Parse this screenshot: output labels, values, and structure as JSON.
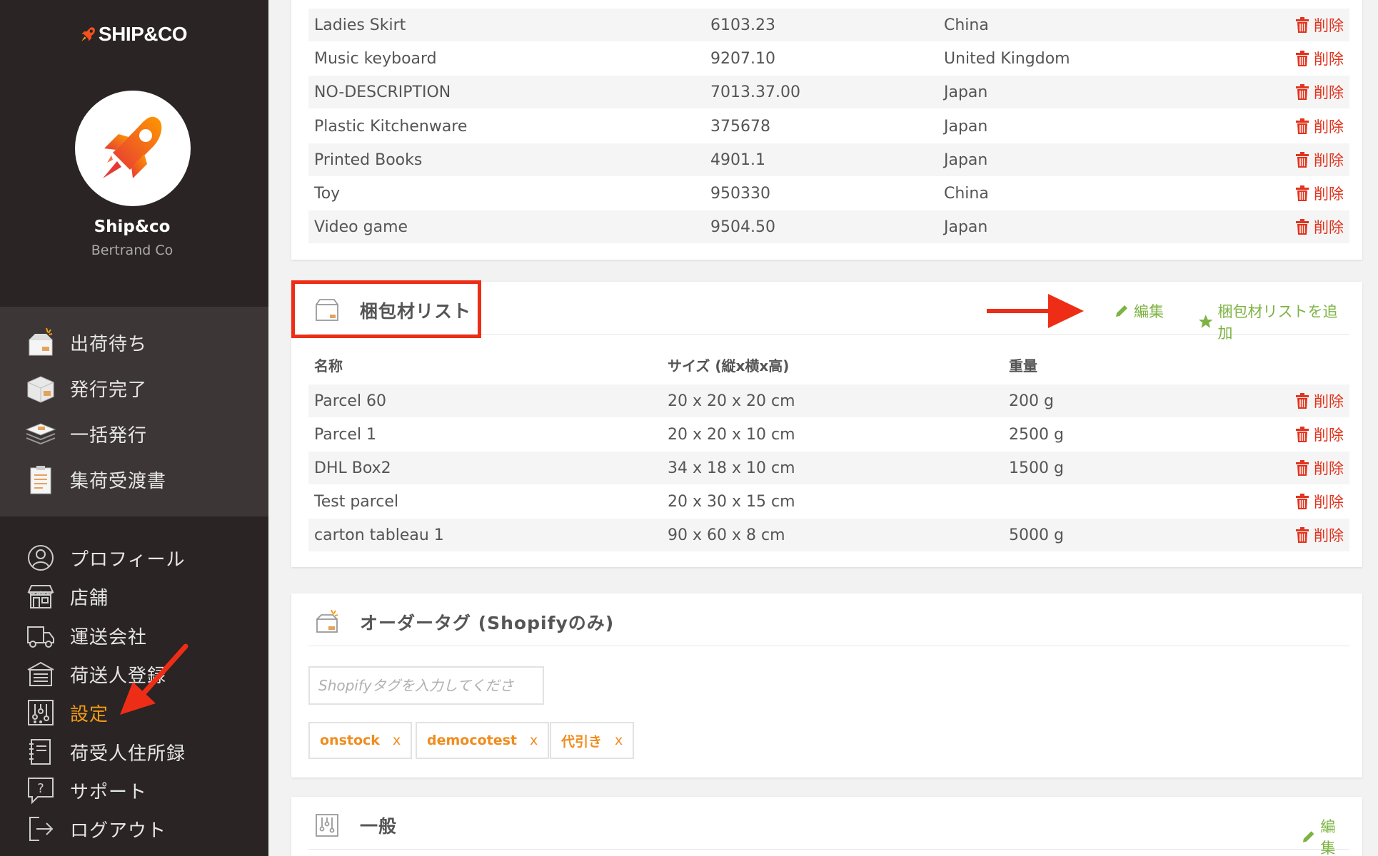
{
  "brand": {
    "logo_text": "SHIP&CO",
    "name": "Ship&co",
    "subtitle": "Bertrand Co"
  },
  "nav_primary": [
    {
      "label": "出荷待ち",
      "icon": "box-open-icon"
    },
    {
      "label": "発行完了",
      "icon": "box-closed-icon"
    },
    {
      "label": "一括発行",
      "icon": "stack-icon"
    },
    {
      "label": "集荷受渡書",
      "icon": "clipboard-icon"
    }
  ],
  "nav_secondary": [
    {
      "label": "プロフィール",
      "icon": "user-icon"
    },
    {
      "label": "店舗",
      "icon": "store-icon"
    },
    {
      "label": "運送会社",
      "icon": "truck-icon"
    },
    {
      "label": "荷送人登録",
      "icon": "warehouse-icon"
    },
    {
      "label": "設定",
      "icon": "sliders-icon",
      "active": true
    },
    {
      "label": "荷受人住所録",
      "icon": "address-book-icon"
    },
    {
      "label": "サポート",
      "icon": "help-icon"
    },
    {
      "label": "ログアウト",
      "icon": "logout-icon"
    }
  ],
  "products": {
    "rows": [
      {
        "name": "Ladies Skirt",
        "code": "6103.23",
        "origin": "China"
      },
      {
        "name": "Music keyboard",
        "code": "9207.10",
        "origin": "United Kingdom"
      },
      {
        "name": "NO-DESCRIPTION",
        "code": "7013.37.00",
        "origin": "Japan"
      },
      {
        "name": "Plastic Kitchenware",
        "code": "375678",
        "origin": "Japan"
      },
      {
        "name": "Printed Books",
        "code": "4901.1",
        "origin": "Japan"
      },
      {
        "name": "Toy",
        "code": "950330",
        "origin": "China"
      },
      {
        "name": "Video game",
        "code": "9504.50",
        "origin": "Japan"
      }
    ],
    "delete_label": "削除"
  },
  "packaging": {
    "title": "梱包材リスト",
    "edit_label": "編集",
    "add_label": "梱包材リストを追加",
    "columns": [
      "名称",
      "サイズ (縦x横x高)",
      "重量"
    ],
    "rows": [
      {
        "name": "Parcel 60",
        "size": "20 x 20 x 20 cm",
        "weight": "200 g"
      },
      {
        "name": "Parcel 1",
        "size": "20 x 20 x 10 cm",
        "weight": "2500 g"
      },
      {
        "name": "DHL Box2",
        "size": "34 x 18 x 10 cm",
        "weight": "1500 g"
      },
      {
        "name": "Test parcel",
        "size": "20 x 30 x 15 cm",
        "weight": ""
      },
      {
        "name": "carton tableau 1",
        "size": "90 x 60 x 8 cm",
        "weight": "5000 g"
      }
    ],
    "delete_label": "削除"
  },
  "order_tags": {
    "title": "オーダータグ (Shopifyのみ)",
    "input_placeholder": "Shopifyタグを入力してくださ",
    "tags": [
      "onstock",
      "democotest",
      "代引き"
    ],
    "remove_label": "x"
  },
  "general": {
    "title": "一般",
    "edit_label": "編集"
  },
  "colors": {
    "sidebar_bg": "#2a2424",
    "accent_orange": "#f39c12",
    "delete_red": "#e0341e",
    "link_green": "#7cb342",
    "annotation_red": "#ee2d16"
  }
}
